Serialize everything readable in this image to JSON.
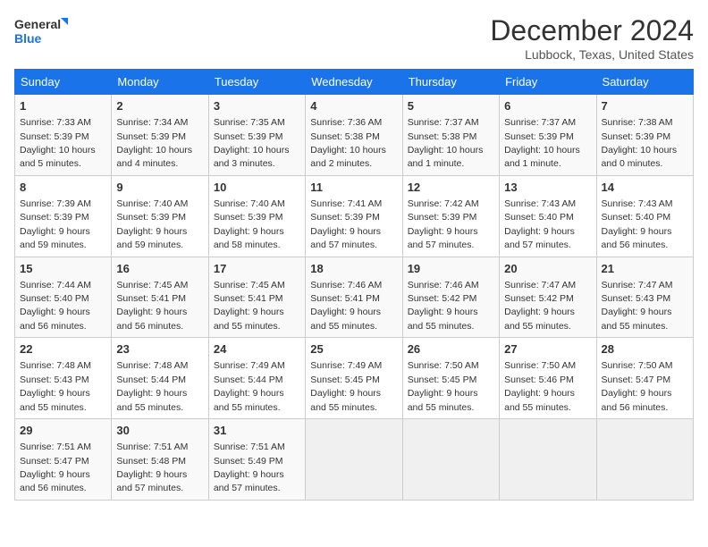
{
  "logo": {
    "line1": "General",
    "line2": "Blue"
  },
  "title": "December 2024",
  "location": "Lubbock, Texas, United States",
  "days_of_week": [
    "Sunday",
    "Monday",
    "Tuesday",
    "Wednesday",
    "Thursday",
    "Friday",
    "Saturday"
  ],
  "weeks": [
    [
      {
        "day": "1",
        "sunrise": "7:33 AM",
        "sunset": "5:39 PM",
        "daylight": "10 hours and 5 minutes."
      },
      {
        "day": "2",
        "sunrise": "7:34 AM",
        "sunset": "5:39 PM",
        "daylight": "10 hours and 4 minutes."
      },
      {
        "day": "3",
        "sunrise": "7:35 AM",
        "sunset": "5:39 PM",
        "daylight": "10 hours and 3 minutes."
      },
      {
        "day": "4",
        "sunrise": "7:36 AM",
        "sunset": "5:38 PM",
        "daylight": "10 hours and 2 minutes."
      },
      {
        "day": "5",
        "sunrise": "7:37 AM",
        "sunset": "5:38 PM",
        "daylight": "10 hours and 1 minute."
      },
      {
        "day": "6",
        "sunrise": "7:37 AM",
        "sunset": "5:39 PM",
        "daylight": "10 hours and 1 minute."
      },
      {
        "day": "7",
        "sunrise": "7:38 AM",
        "sunset": "5:39 PM",
        "daylight": "10 hours and 0 minutes."
      }
    ],
    [
      {
        "day": "8",
        "sunrise": "7:39 AM",
        "sunset": "5:39 PM",
        "daylight": "9 hours and 59 minutes."
      },
      {
        "day": "9",
        "sunrise": "7:40 AM",
        "sunset": "5:39 PM",
        "daylight": "9 hours and 59 minutes."
      },
      {
        "day": "10",
        "sunrise": "7:40 AM",
        "sunset": "5:39 PM",
        "daylight": "9 hours and 58 minutes."
      },
      {
        "day": "11",
        "sunrise": "7:41 AM",
        "sunset": "5:39 PM",
        "daylight": "9 hours and 57 minutes."
      },
      {
        "day": "12",
        "sunrise": "7:42 AM",
        "sunset": "5:39 PM",
        "daylight": "9 hours and 57 minutes."
      },
      {
        "day": "13",
        "sunrise": "7:43 AM",
        "sunset": "5:40 PM",
        "daylight": "9 hours and 57 minutes."
      },
      {
        "day": "14",
        "sunrise": "7:43 AM",
        "sunset": "5:40 PM",
        "daylight": "9 hours and 56 minutes."
      }
    ],
    [
      {
        "day": "15",
        "sunrise": "7:44 AM",
        "sunset": "5:40 PM",
        "daylight": "9 hours and 56 minutes."
      },
      {
        "day": "16",
        "sunrise": "7:45 AM",
        "sunset": "5:41 PM",
        "daylight": "9 hours and 56 minutes."
      },
      {
        "day": "17",
        "sunrise": "7:45 AM",
        "sunset": "5:41 PM",
        "daylight": "9 hours and 55 minutes."
      },
      {
        "day": "18",
        "sunrise": "7:46 AM",
        "sunset": "5:41 PM",
        "daylight": "9 hours and 55 minutes."
      },
      {
        "day": "19",
        "sunrise": "7:46 AM",
        "sunset": "5:42 PM",
        "daylight": "9 hours and 55 minutes."
      },
      {
        "day": "20",
        "sunrise": "7:47 AM",
        "sunset": "5:42 PM",
        "daylight": "9 hours and 55 minutes."
      },
      {
        "day": "21",
        "sunrise": "7:47 AM",
        "sunset": "5:43 PM",
        "daylight": "9 hours and 55 minutes."
      }
    ],
    [
      {
        "day": "22",
        "sunrise": "7:48 AM",
        "sunset": "5:43 PM",
        "daylight": "9 hours and 55 minutes."
      },
      {
        "day": "23",
        "sunrise": "7:48 AM",
        "sunset": "5:44 PM",
        "daylight": "9 hours and 55 minutes."
      },
      {
        "day": "24",
        "sunrise": "7:49 AM",
        "sunset": "5:44 PM",
        "daylight": "9 hours and 55 minutes."
      },
      {
        "day": "25",
        "sunrise": "7:49 AM",
        "sunset": "5:45 PM",
        "daylight": "9 hours and 55 minutes."
      },
      {
        "day": "26",
        "sunrise": "7:50 AM",
        "sunset": "5:45 PM",
        "daylight": "9 hours and 55 minutes."
      },
      {
        "day": "27",
        "sunrise": "7:50 AM",
        "sunset": "5:46 PM",
        "daylight": "9 hours and 55 minutes."
      },
      {
        "day": "28",
        "sunrise": "7:50 AM",
        "sunset": "5:47 PM",
        "daylight": "9 hours and 56 minutes."
      }
    ],
    [
      {
        "day": "29",
        "sunrise": "7:51 AM",
        "sunset": "5:47 PM",
        "daylight": "9 hours and 56 minutes."
      },
      {
        "day": "30",
        "sunrise": "7:51 AM",
        "sunset": "5:48 PM",
        "daylight": "9 hours and 57 minutes."
      },
      {
        "day": "31",
        "sunrise": "7:51 AM",
        "sunset": "5:49 PM",
        "daylight": "9 hours and 57 minutes."
      },
      null,
      null,
      null,
      null
    ]
  ]
}
